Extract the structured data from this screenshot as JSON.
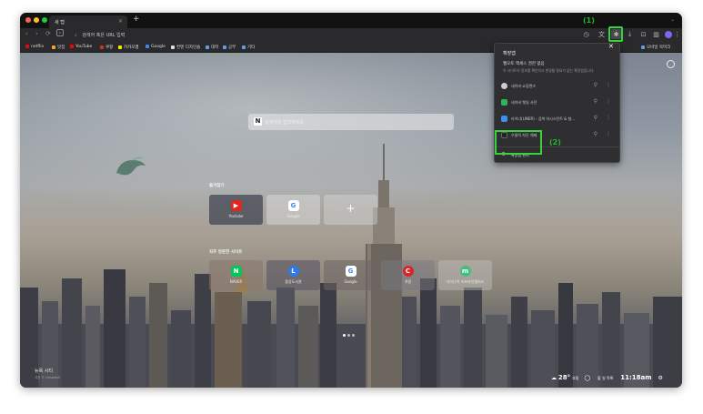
{
  "tab": {
    "title": "새 탭",
    "close": "×",
    "new": "+"
  },
  "toolbar": {
    "back": "‹",
    "forward": "›",
    "reload": "⟳",
    "omnibox_text": "검색어 혹은 URL 입력"
  },
  "annotations": {
    "a1": "(1)",
    "a2": "(2)"
  },
  "bookmarks": [
    {
      "label": "netflix",
      "color": "#e50914"
    },
    {
      "label": "맛집",
      "color": "#f5a623"
    },
    {
      "label": "YouTube",
      "color": "#ff0000"
    },
    {
      "label": "쿠팡",
      "color": "#d32f2f"
    },
    {
      "label": "카카오맵",
      "color": "#fee500"
    },
    {
      "label": "Google",
      "color": "#4285f4"
    },
    {
      "label": "컨텐 디자인숍",
      "color": "#e0e0e0"
    },
    {
      "label": "대학",
      "color": "#5ea0e8"
    },
    {
      "label": "공부",
      "color": "#5ea0e8"
    },
    {
      "label": "기타",
      "color": "#5ea0e8"
    }
  ],
  "bookmarks_right": "모바일 북마크",
  "search": {
    "placeholder": "검색어를 입력하세요",
    "logo": "N"
  },
  "sections": {
    "favorites": "즐겨찾기",
    "frequent": "자주 방문한 사이트"
  },
  "favorites": [
    {
      "label": "Youtube",
      "letter": "▶",
      "color": "#e0261e"
    },
    {
      "label": "Google",
      "letter": "G",
      "color": "#4285f4"
    },
    {
      "label": "",
      "letter": "+",
      "color": "transparent"
    }
  ],
  "frequent": [
    {
      "label": "NAVER",
      "letter": "N",
      "color": "#03c75a"
    },
    {
      "label": "중앙도서관",
      "letter": "L",
      "color": "#2f7be8"
    },
    {
      "label": "Google",
      "letter": "G",
      "color": "#4285f4"
    },
    {
      "label": "쿠팡",
      "letter": "C",
      "color": "#d7262b"
    },
    {
      "label": "다이나믹 오프라인캠퍼스",
      "letter": "m",
      "color": "#3fbf7f"
    }
  ],
  "bottom": {
    "location": "뉴욕 시티",
    "credit": "사진 © Unsplash",
    "weather_temp": "28°",
    "weather_desc": "흐림",
    "weather_extra": "할 일 목록",
    "time": "11:18am"
  },
  "extension_panel": {
    "title": "확장앱",
    "subtitle": "웹오토 액세스 권한 없음",
    "desc": "이 사이트의 정보를 확인하고 변경할 필요가 없는 확장앱입니다.",
    "items": [
      {
        "name": "네이버 쇼핑렌즈",
        "color": "#cccccc"
      },
      {
        "name": "네이버 웨일 사전",
        "color": "#2fb45a"
      },
      {
        "name": "라이너(LINER) - 검색 어시스턴트 & 형...",
        "color": "#3f8ff0"
      },
      {
        "name": "우클릭 차단 해제",
        "color": "#222222"
      }
    ],
    "manage": "확장앱 관리",
    "pin": "⚲",
    "more": "⋮"
  }
}
